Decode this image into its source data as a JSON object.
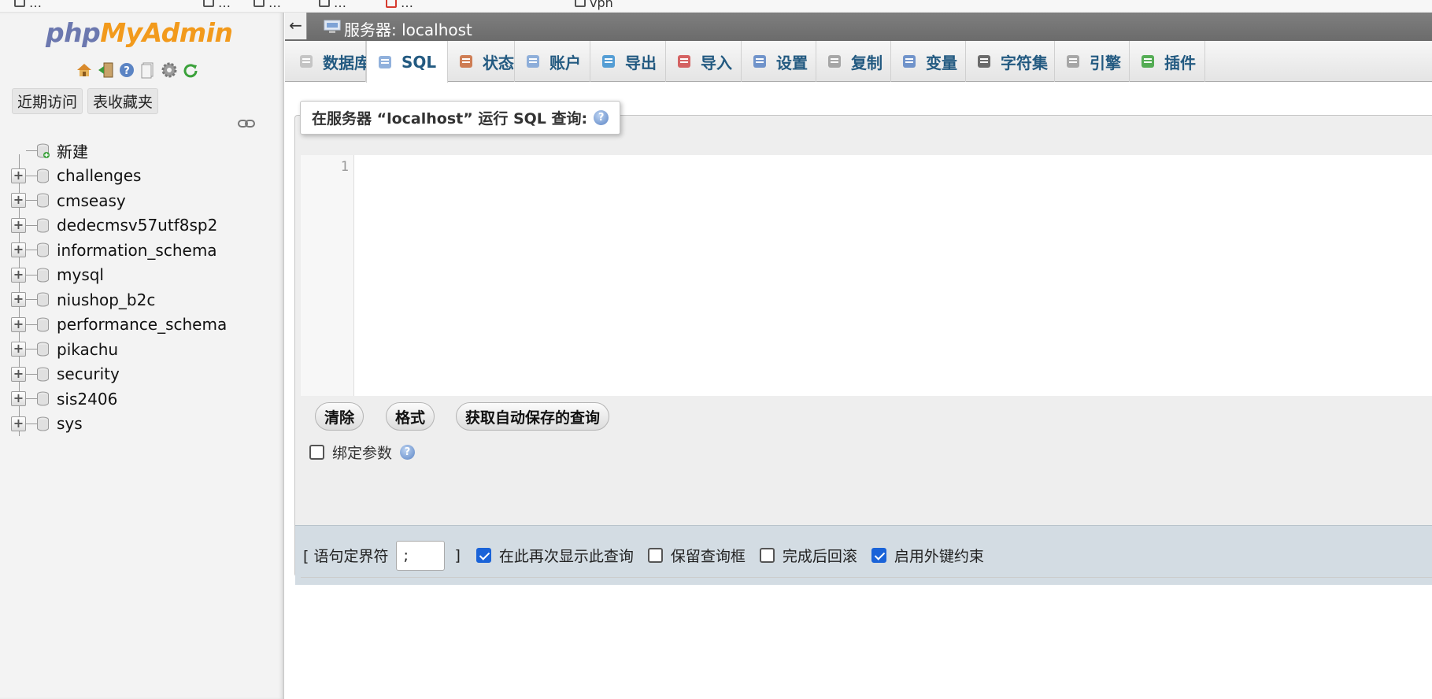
{
  "bookmarks": [
    {
      "label": "…",
      "icon": "folder-icon"
    },
    {
      "label": "…",
      "icon": "folder-icon"
    },
    {
      "label": "…",
      "icon": "folder-icon"
    },
    {
      "label": "…",
      "icon": "folder-icon"
    },
    {
      "label": "…",
      "icon": "pdf-icon"
    },
    {
      "label": "vpn",
      "icon": "folder-icon"
    }
  ],
  "nav": {
    "logo_php": "php",
    "logo_myadmin": "MyAdmin",
    "icons": [
      "home-icon",
      "logout-icon",
      "help-icon",
      "docs-icon",
      "settings-icon",
      "reload-icon"
    ],
    "tabs": [
      "近期访问",
      "表收藏夹"
    ],
    "tree": [
      {
        "label": "新建",
        "type": "new"
      },
      {
        "label": "challenges",
        "type": "db"
      },
      {
        "label": "cmseasy",
        "type": "db"
      },
      {
        "label": "dedecmsv57utf8sp2",
        "type": "db"
      },
      {
        "label": "information_schema",
        "type": "db"
      },
      {
        "label": "mysql",
        "type": "db"
      },
      {
        "label": "niushop_b2c",
        "type": "db"
      },
      {
        "label": "performance_schema",
        "type": "db"
      },
      {
        "label": "pikachu",
        "type": "db"
      },
      {
        "label": "security",
        "type": "db"
      },
      {
        "label": "sis2406",
        "type": "db"
      },
      {
        "label": "sys",
        "type": "db"
      }
    ]
  },
  "server": {
    "back": "←",
    "title": "服务器: localhost"
  },
  "tabs": [
    {
      "label": "数据库",
      "icon": "database-icon",
      "active": false
    },
    {
      "label": "SQL",
      "icon": "sql-icon",
      "active": true
    },
    {
      "label": "状态",
      "icon": "status-icon",
      "active": false
    },
    {
      "label": "账户",
      "icon": "accounts-icon",
      "active": false
    },
    {
      "label": "导出",
      "icon": "export-icon",
      "active": false
    },
    {
      "label": "导入",
      "icon": "import-icon",
      "active": false
    },
    {
      "label": "设置",
      "icon": "wrench-icon",
      "active": false
    },
    {
      "label": "复制",
      "icon": "replication-icon",
      "active": false
    },
    {
      "label": "变量",
      "icon": "variables-icon",
      "active": false
    },
    {
      "label": "字符集",
      "icon": "charset-icon",
      "active": false
    },
    {
      "label": "引擎",
      "icon": "engine-icon",
      "active": false
    },
    {
      "label": "插件",
      "icon": "plugin-icon",
      "active": false
    }
  ],
  "sql": {
    "legend": "在服务器 “localhost” 运行 SQL 查询:",
    "line_number": "1",
    "editor_value": "",
    "buttons": {
      "clear": "清除",
      "format": "格式",
      "autosave": "获取自动保存的查询"
    },
    "bind_params": "绑定参数",
    "bind_params_checked": false,
    "delimiter_label_open": "[ 语句定界符",
    "delimiter_value": ";",
    "delimiter_label_close": "]",
    "options": [
      {
        "label": "在此再次显示此查询",
        "checked": true
      },
      {
        "label": "保留查询框",
        "checked": false
      },
      {
        "label": "完成后回滚",
        "checked": false
      },
      {
        "label": "启用外键约束",
        "checked": true
      }
    ]
  },
  "colors": {
    "tab_text": "#235a81",
    "server_bar": "#747474",
    "logo_php": "#6c78af",
    "logo_myadmin": "#f29a1c",
    "checkbox_on": "#1a63d8",
    "options_bar": "#d3dce3"
  }
}
